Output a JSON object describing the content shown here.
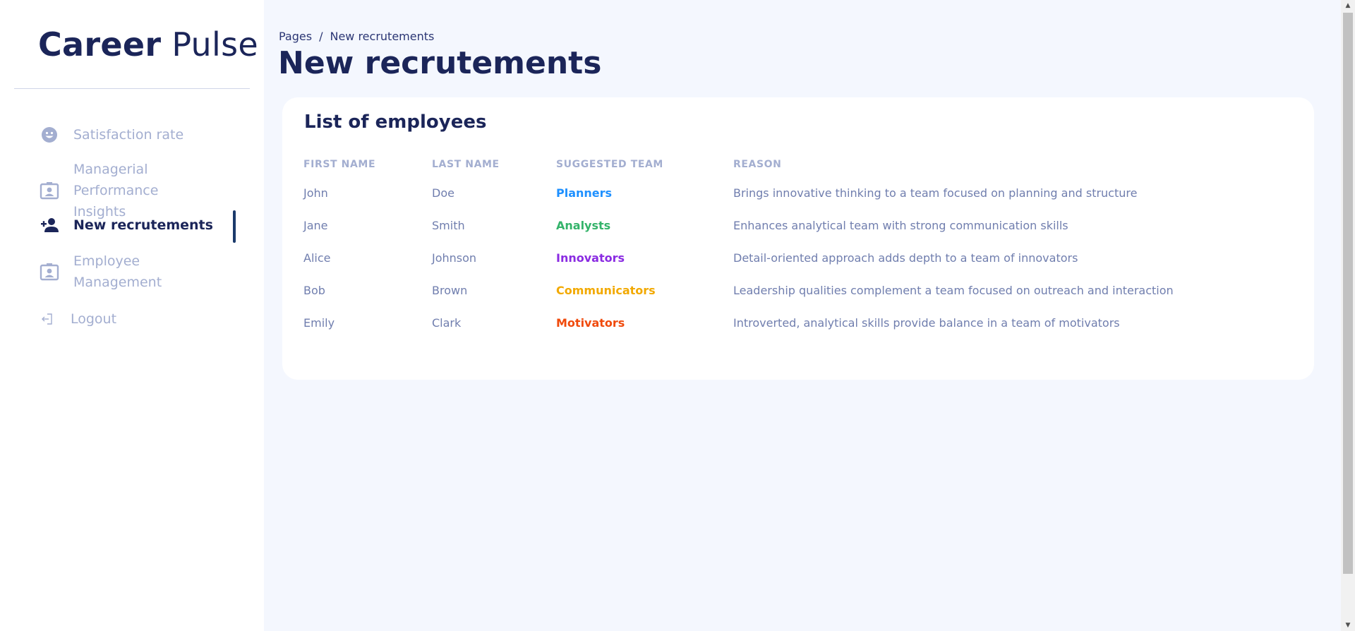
{
  "sidebar": {
    "brand_bold": "Career",
    "brand_light": "Pulse",
    "items": [
      {
        "label": "Satisfaction rate",
        "icon": "smiley-icon"
      },
      {
        "label": "Managerial Performance Insights",
        "icon": "user-card-icon"
      },
      {
        "label": "New recrutements",
        "icon": "person-add-icon"
      },
      {
        "label": "Employee Management",
        "icon": "user-card-icon"
      },
      {
        "label": "Logout",
        "icon": "logout-icon"
      }
    ],
    "active_index": 2
  },
  "header": {
    "breadcrumb_root": "Pages",
    "breadcrumb_separator": "/",
    "breadcrumb_current": "New recrutements",
    "title": "New recrutements"
  },
  "card": {
    "title": "List of employees",
    "columns": [
      "FIRST NAME",
      "LAST NAME",
      "SUGGESTED TEAM",
      "REASON"
    ],
    "rows": [
      {
        "first": "John",
        "last": "Doe",
        "team": "Planners",
        "team_color": "#1e90ff",
        "reason": "Brings innovative thinking to a team focused on planning and structure"
      },
      {
        "first": "Jane",
        "last": "Smith",
        "team": "Analysts",
        "team_color": "#34b36a",
        "reason": "Enhances analytical team with strong communication skills"
      },
      {
        "first": "Alice",
        "last": "Johnson",
        "team": "Innovators",
        "team_color": "#8a2be2",
        "reason": "Detail-oriented approach adds depth to a team of innovators"
      },
      {
        "first": "Bob",
        "last": "Brown",
        "team": "Communicators",
        "team_color": "#f2a900",
        "reason": "Leadership qualities complement a team focused on outreach and interaction"
      },
      {
        "first": "Emily",
        "last": "Clark",
        "team": "Motivators",
        "team_color": "#f04a0c",
        "reason": "Introverted, analytical skills provide balance in a team of motivators"
      }
    ]
  },
  "colors": {
    "navy": "#1b2559",
    "muted": "#a3aed0",
    "background": "#f4f7fe",
    "active_bar": "#1b3a6b"
  }
}
